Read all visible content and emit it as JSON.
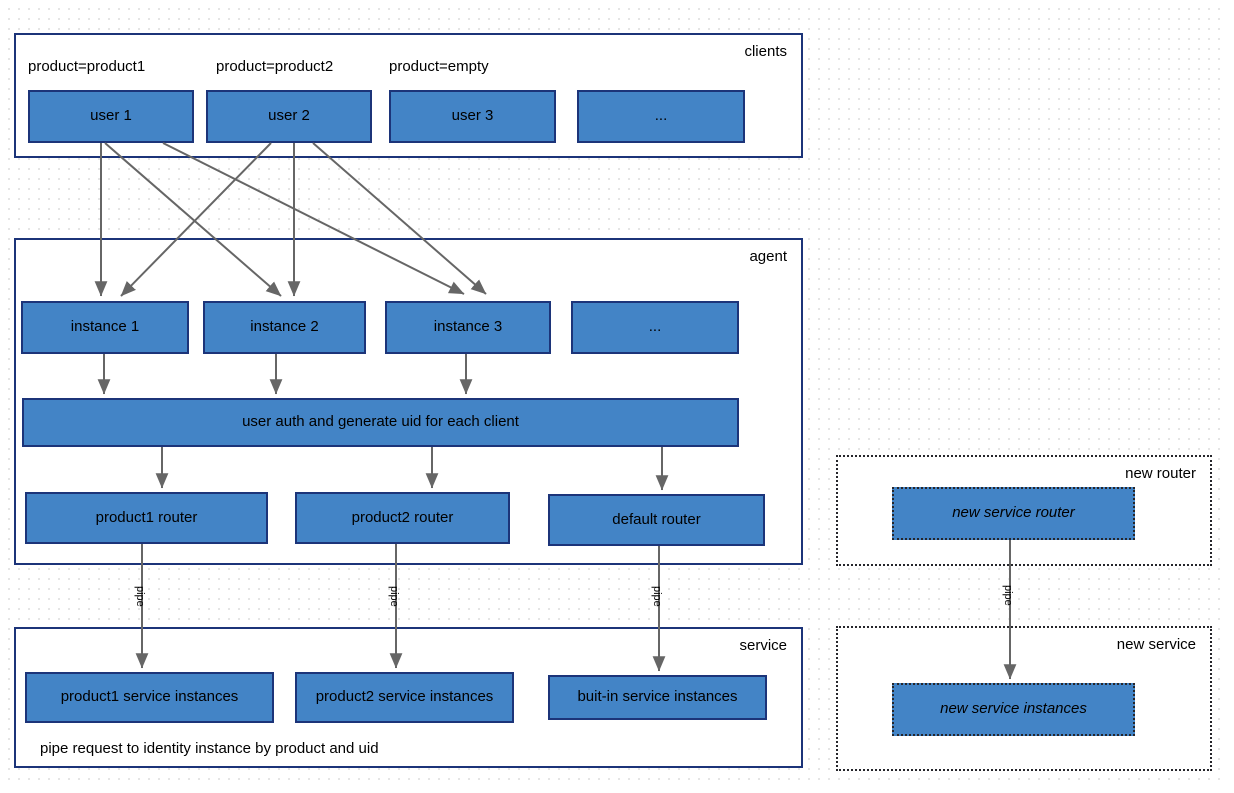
{
  "diagram": {
    "background_color": "#ffffff",
    "node_fill": "#4384c6",
    "node_border": "#1c3479",
    "panel_border": "#1c3479",
    "edge_color": "#666666"
  },
  "panels": {
    "clients": {
      "title": "clients",
      "labels": [
        "product=product1",
        "product=product2",
        "product=empty"
      ],
      "nodes": [
        "user 1",
        "user 2",
        "user 3",
        "..."
      ]
    },
    "agent": {
      "title": "agent",
      "instances": [
        "instance 1",
        "instance 2",
        "instance 3",
        "..."
      ],
      "auth_bar": "user auth and generate uid for each client",
      "routers": [
        "product1 router",
        "product2 router",
        "default router"
      ]
    },
    "service": {
      "title": "service",
      "nodes": [
        "product1 service instances",
        "product2 service instances",
        "buit-in service instances"
      ],
      "footnote": "pipe request to identity instance by product and uid"
    },
    "new_router": {
      "title": "new router",
      "node": "new service router"
    },
    "new_service": {
      "title": "new service",
      "node": "new service instances"
    }
  },
  "edge_labels": {
    "pipe": "pipe"
  }
}
